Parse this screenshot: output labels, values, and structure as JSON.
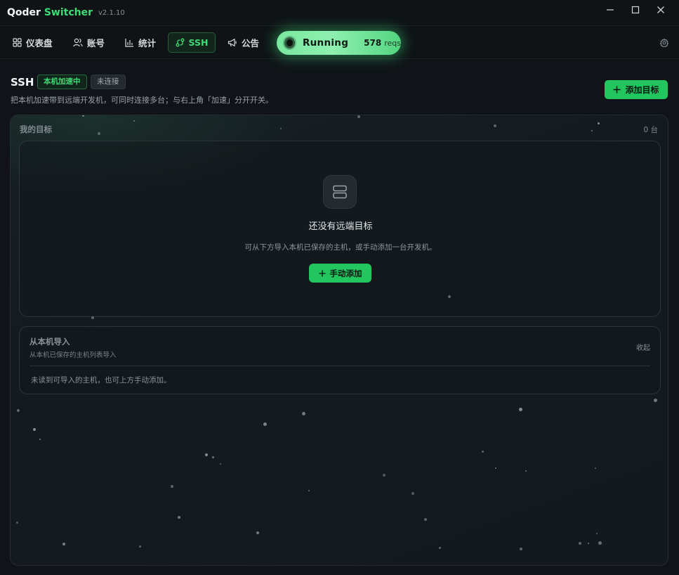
{
  "app": {
    "title_part1": "Qoder",
    "title_part2": "Switcher",
    "version": "v2.1.10"
  },
  "window_controls": {
    "minimize_icon": "minimize-icon",
    "maximize_icon": "maximize-icon",
    "close_icon": "close-icon"
  },
  "nav": {
    "items": [
      {
        "label": "仪表盘",
        "icon": "dashboard-grid-icon"
      },
      {
        "label": "账号",
        "icon": "users-icon"
      },
      {
        "label": "统计",
        "icon": "bar-chart-icon"
      },
      {
        "label": "SSH",
        "icon": "ssh-route-icon",
        "active": true
      },
      {
        "label": "公告",
        "icon": "megaphone-icon"
      }
    ],
    "running": {
      "label": "Running",
      "count": "578",
      "unit": "reqs"
    },
    "settings_icon": "gear-icon"
  },
  "header": {
    "title": "SSH",
    "badge_accel": "本机加速中",
    "badge_conn": "未连接",
    "subtitle": "把本机加速带到远端开发机，可同时连接多台；与右上角「加速」分开开关。",
    "add_target_label": "添加目标"
  },
  "targets": {
    "heading": "我的目标",
    "count_label": "0 台",
    "empty": {
      "icon": "server-icon",
      "title": "还没有远端目标",
      "description": "可从下方导入本机已保存的主机，或手动添加一台开发机。",
      "button_label": "手动添加"
    }
  },
  "import": {
    "title": "从本机导入",
    "subtitle": "从本机已保存的主机列表导入",
    "collapse_label": "收起",
    "empty_text": "未读到可导入的主机，也可上方手动添加。"
  },
  "colors": {
    "accent": "#22c55e",
    "accent_text": "#3ddc76",
    "background": "#101418",
    "card": "#151b20"
  }
}
